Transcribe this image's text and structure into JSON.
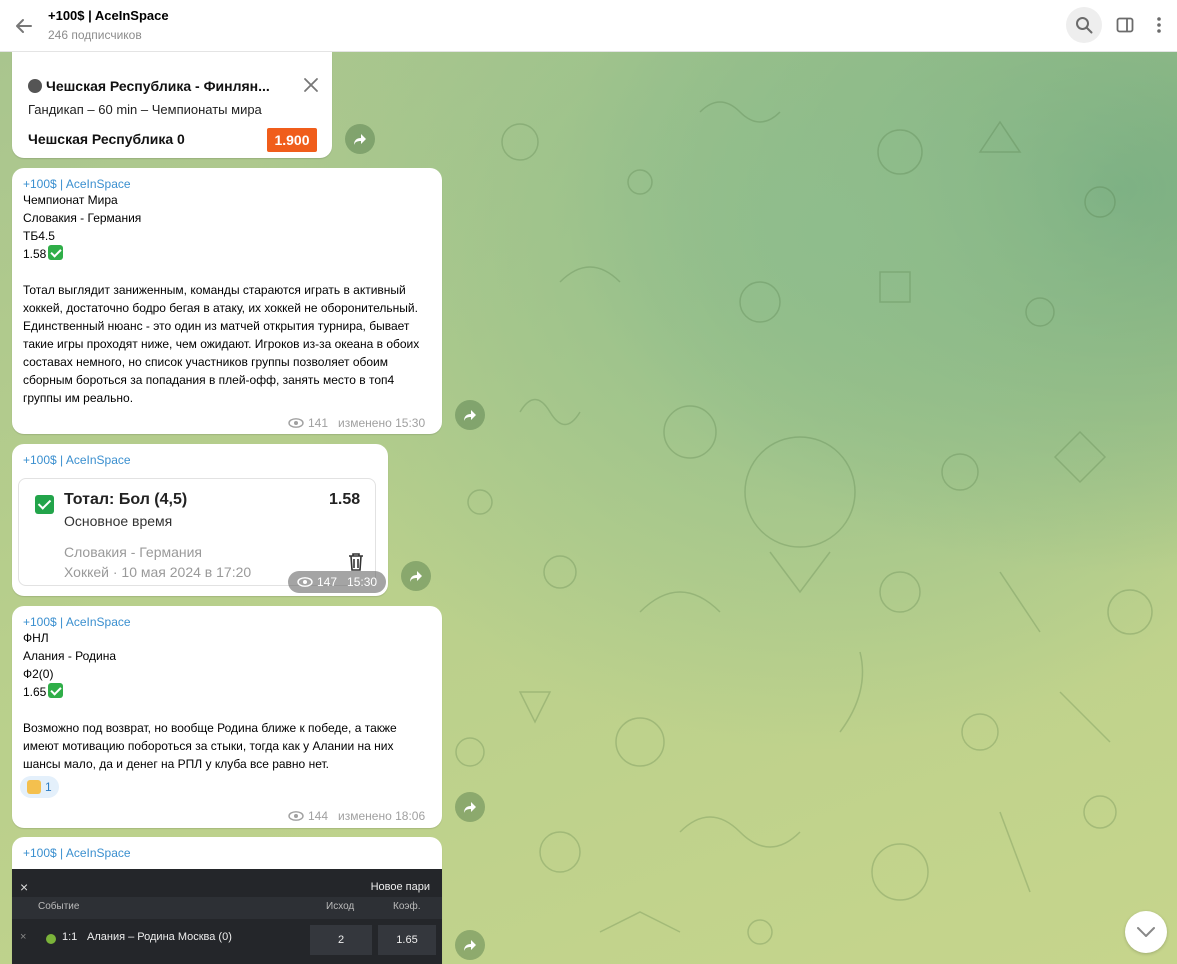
{
  "header": {
    "title": "+100$ | AceInSpace",
    "subscribers": "246 подписчиков"
  },
  "messages": [
    {
      "bet_card": {
        "title": "Чешская Республика - Финлян...",
        "subtitle": "Гандикап – 60 min – Чемпионаты мира",
        "pick": "Чешская Республика 0",
        "odds": "1.900"
      }
    },
    {
      "author": "+100$ | AceInSpace",
      "lines": [
        "Чемпионат Мира",
        "Словакия - Германия",
        "ТБ4.5",
        "1.58"
      ],
      "text": "Тотал выглядит заниженным, команды стараются играть в активный хоккей, достаточно бодро бегая в атаку, их хоккей не оборонительный. Единственный нюанс - это один из матчей открытия турнира, бывает такие игры проходят ниже, чем ожидают. Игроков из-за океана в обоих составах немного, но список участников группы позволяет обоим сборным бороться за попадания в плей-офф, занять место в топ4 группы им реально.",
      "views": "141",
      "time": "изменено 15:30"
    },
    {
      "author": "+100$ | AceInSpace",
      "slip": {
        "title": "Тотал: Бол (4,5)",
        "odds": "1.58",
        "period": "Основное время",
        "match": "Словакия - Германия",
        "date": "Хоккей · 10 мая 2024 в 17:20"
      },
      "views": "147",
      "time": "15:30"
    },
    {
      "author": "+100$ | AceInSpace",
      "lines": [
        "ФНЛ",
        "Алания - Родина",
        "Ф2(0)",
        "1.65"
      ],
      "text": "Возможно под возврат, но вообще Родина ближе к победе, а также имеют мотивацию побороться за стыки, тогда как у Алании на них шансы мало, да и денег на РПЛ у клуба все равно нет.",
      "reaction_count": "1",
      "views": "144",
      "time": "изменено 18:06"
    },
    {
      "author": "+100$ | AceInSpace",
      "screenshot": {
        "close": "×",
        "title": "Новое пари",
        "col_event": "Событие",
        "col_outcome": "Исход",
        "col_odds": "Коэф.",
        "row_x": "×",
        "row_score": "1:1",
        "row_event": "Алания – Родина Москва (0)",
        "row_outcome": "2",
        "row_odds": "1.65"
      }
    }
  ],
  "colors": {
    "accent": "#3a8fcf",
    "odds_badge": "#f05d1b",
    "check_green": "#2fae48"
  }
}
